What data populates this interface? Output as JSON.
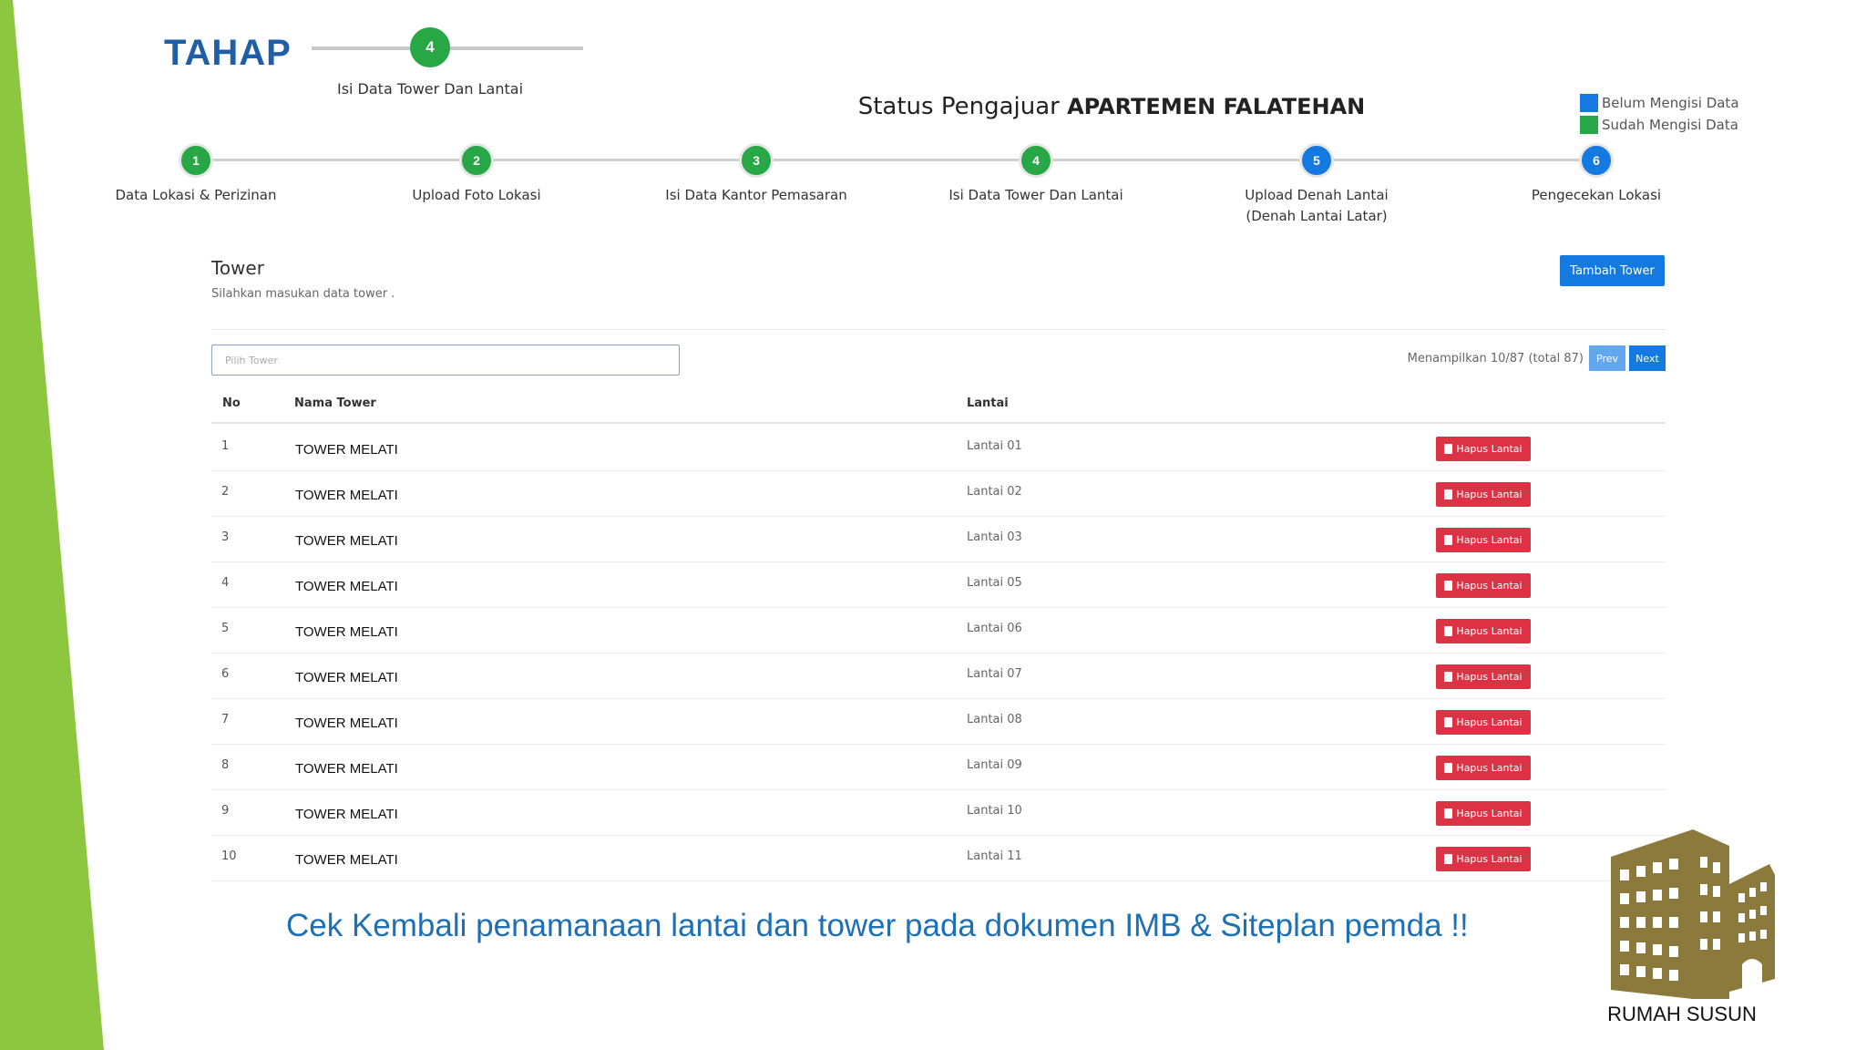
{
  "colors": {
    "band_green": "#8dc63f",
    "heading_blue": "#1f5fa8",
    "step_done_green": "#27a745",
    "step_pending_blue": "#1479e0",
    "danger_red": "#db3345",
    "logo_gold": "#8b7a3c"
  },
  "stage": {
    "title": "TAHAP",
    "number": "4",
    "label": "Isi Data Tower Dan Lantai"
  },
  "status": {
    "prefix": "Status Pengajuar",
    "project_name": "APARTEMEN FALATEHAN"
  },
  "legend": [
    {
      "label": "Belum Mengisi Data",
      "color": "#1479e0"
    },
    {
      "label": "Sudah Mengisi Data",
      "color": "#27a745"
    }
  ],
  "steps": [
    {
      "num": "1",
      "label": "Data Lokasi & Perizinan",
      "state": "done"
    },
    {
      "num": "2",
      "label": "Upload Foto Lokasi",
      "state": "done"
    },
    {
      "num": "3",
      "label": "Isi Data Kantor Pemasaran",
      "state": "done"
    },
    {
      "num": "4",
      "label": "Isi Data Tower Dan Lantai",
      "state": "done"
    },
    {
      "num": "5",
      "label": "Upload Denah Lantai\n(Denah Lantai Latar)",
      "state": "pending"
    },
    {
      "num": "6",
      "label": "Pengecekan Lokasi",
      "state": "pending"
    }
  ],
  "panel": {
    "title": "Tower",
    "subtitle": "Silahkan masukan data tower .",
    "add_button": "Tambah Tower",
    "filter_placeholder": "Pilih Tower",
    "paging_info": "Menampilkan 10/87 (total 87)",
    "prev": "Prev",
    "next": "Next"
  },
  "table": {
    "columns": {
      "no": "No",
      "name": "Nama Tower",
      "floor": "Lantai"
    },
    "delete_label": "Hapus Lantai",
    "rows": [
      {
        "no": "1",
        "name": "TOWER MELATI",
        "floor": "Lantai 01"
      },
      {
        "no": "2",
        "name": "TOWER MELATI",
        "floor": "Lantai 02"
      },
      {
        "no": "3",
        "name": "TOWER MELATI",
        "floor": "Lantai 03"
      },
      {
        "no": "4",
        "name": "TOWER MELATI",
        "floor": "Lantai 05"
      },
      {
        "no": "5",
        "name": "TOWER MELATI",
        "floor": "Lantai 06"
      },
      {
        "no": "6",
        "name": "TOWER MELATI",
        "floor": "Lantai 07"
      },
      {
        "no": "7",
        "name": "TOWER MELATI",
        "floor": "Lantai 08"
      },
      {
        "no": "8",
        "name": "TOWER MELATI",
        "floor": "Lantai 09"
      },
      {
        "no": "9",
        "name": "TOWER MELATI",
        "floor": "Lantai 10"
      },
      {
        "no": "10",
        "name": "TOWER MELATI",
        "floor": "Lantai 11"
      }
    ]
  },
  "notice": "Cek Kembali penamanaan lantai dan tower pada dokumen IMB & Siteplan pemda !!",
  "logo": {
    "caption": "RUMAH SUSUN",
    "icon": "apartment-building-icon"
  }
}
